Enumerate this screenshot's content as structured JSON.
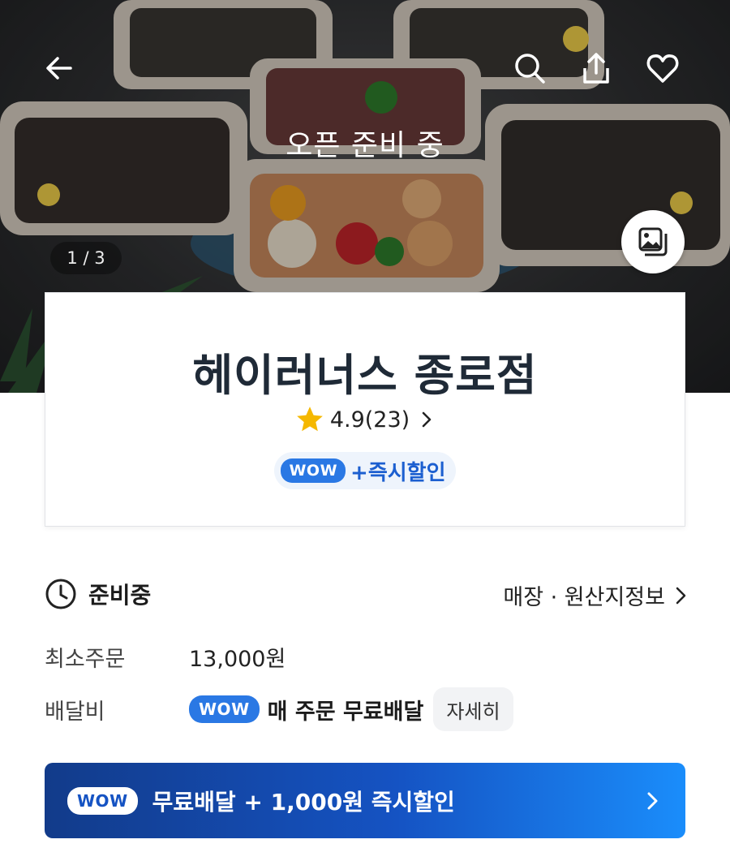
{
  "hero": {
    "status_overlay": "오픈 준비 중",
    "pager": "1 / 3",
    "icons": [
      "back-arrow-icon",
      "search-icon",
      "share-icon",
      "heart-icon",
      "gallery-icon"
    ]
  },
  "store": {
    "name": "헤이러너스 종로점",
    "rating": "4.9(23)",
    "wow_badge": "WOW",
    "wow_promo": "+즉시할인"
  },
  "info": {
    "status": "준비중",
    "store_info_link": "매장 · 원산지정보",
    "min_order_label": "최소주문",
    "min_order_value": "13,000원",
    "delivery_fee_label": "배달비",
    "delivery_wow_badge": "WOW",
    "delivery_fee_text": "매 주문 무료배달",
    "detail_button": "자세히"
  },
  "promo_banner": {
    "badge": "WOW",
    "text": "무료배달 + 1,000원 즉시할인"
  },
  "colors": {
    "wow_blue": "#2a78e4",
    "banner_dark": "#123b8a",
    "banner_light": "#1a8dfb",
    "star": "#f5b800"
  }
}
